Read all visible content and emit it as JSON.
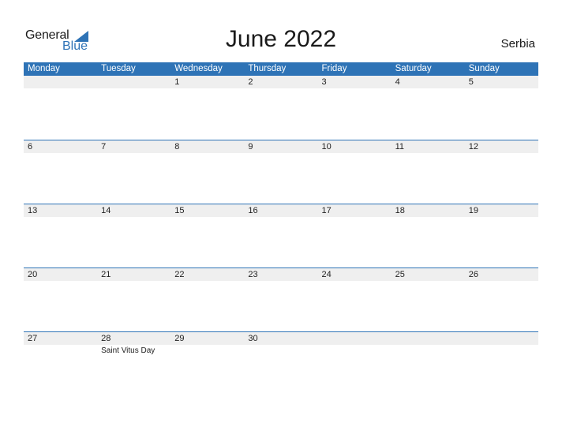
{
  "logo": {
    "word1": "General",
    "word2": "Blue"
  },
  "title": "June 2022",
  "country": "Serbia",
  "colors": {
    "accent": "#2e73b6",
    "band": "#efefef"
  },
  "weekdays": [
    "Monday",
    "Tuesday",
    "Wednesday",
    "Thursday",
    "Friday",
    "Saturday",
    "Sunday"
  ],
  "weeks": [
    [
      {
        "day": ""
      },
      {
        "day": ""
      },
      {
        "day": "1"
      },
      {
        "day": "2"
      },
      {
        "day": "3"
      },
      {
        "day": "4"
      },
      {
        "day": "5"
      }
    ],
    [
      {
        "day": "6"
      },
      {
        "day": "7"
      },
      {
        "day": "8"
      },
      {
        "day": "9"
      },
      {
        "day": "10"
      },
      {
        "day": "11"
      },
      {
        "day": "12"
      }
    ],
    [
      {
        "day": "13"
      },
      {
        "day": "14"
      },
      {
        "day": "15"
      },
      {
        "day": "16"
      },
      {
        "day": "17"
      },
      {
        "day": "18"
      },
      {
        "day": "19"
      }
    ],
    [
      {
        "day": "20"
      },
      {
        "day": "21"
      },
      {
        "day": "22"
      },
      {
        "day": "23"
      },
      {
        "day": "24"
      },
      {
        "day": "25"
      },
      {
        "day": "26"
      }
    ],
    [
      {
        "day": "27"
      },
      {
        "day": "28",
        "event": "Saint Vitus Day"
      },
      {
        "day": "29"
      },
      {
        "day": "30"
      },
      {
        "day": ""
      },
      {
        "day": ""
      },
      {
        "day": ""
      }
    ]
  ]
}
